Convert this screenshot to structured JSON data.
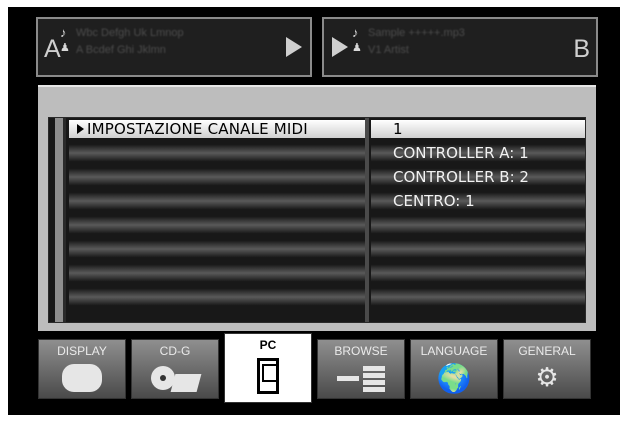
{
  "deck_a": {
    "letter": "A",
    "track_title": "Wbc Defgh Uk Lmnop",
    "track_artist": "A Bcdef Ghi Jklmn"
  },
  "deck_b": {
    "letter": "B",
    "track_title": "Sample +++++.mp3",
    "track_artist": "V1 Artist"
  },
  "menu": {
    "selected_item": "IMPOSTAZIONE CANALE MIDI",
    "values": [
      "1",
      "CONTROLLER A: 1",
      "CONTROLLER B: 2",
      "CENTRO: 1"
    ]
  },
  "tabs": [
    {
      "label": "DISPLAY",
      "icon": "display-icon"
    },
    {
      "label": "CD-G",
      "icon": "cdg-icon"
    },
    {
      "label": "PC",
      "icon": "pc-icon"
    },
    {
      "label": "BROWSE",
      "icon": "browse-icon"
    },
    {
      "label": "LANGUAGE",
      "icon": "world-map-icon"
    },
    {
      "label": "GENERAL",
      "icon": "tools-icon"
    }
  ],
  "active_tab": "PC"
}
